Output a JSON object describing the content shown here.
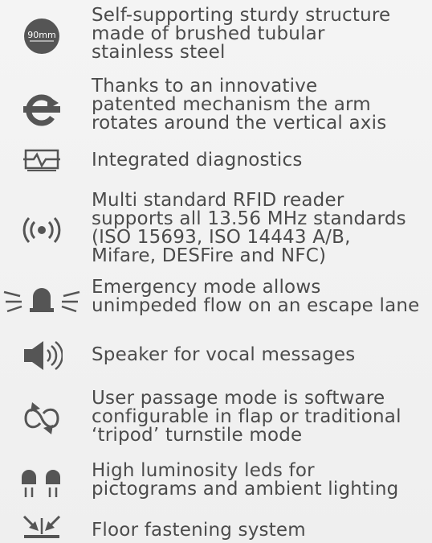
{
  "features": [
    {
      "icon": "tube-diameter-icon",
      "badge": "90mm",
      "text": "Self-supporting sturdy structure\nmade of brushed tubular\nstainless steel"
    },
    {
      "icon": "rotation-icon",
      "text": "Thanks to an innovative\npatented mechanism the arm\nrotates around the vertical axis"
    },
    {
      "icon": "diagnostics-icon",
      "text": "Integrated diagnostics"
    },
    {
      "icon": "rfid-icon",
      "text": "Multi standard RFID reader\nsupports all 13.56 MHz standards\n(ISO 15693, ISO 14443 A/B,\nMifare, DESFire and NFC)"
    },
    {
      "icon": "emergency-light-icon",
      "text": "Emergency mode allows\nunimpeded flow on an escape lane"
    },
    {
      "icon": "speaker-icon",
      "text": "Speaker for vocal messages"
    },
    {
      "icon": "passage-mode-icon",
      "text": "User passage mode is software\nconfigurable in flap or traditional\n‘tripod’ turnstile mode"
    },
    {
      "icon": "led-icon",
      "text": "High luminosity leds for\npictograms and ambient lighting"
    },
    {
      "icon": "floor-fastening-icon",
      "text": "Floor fastening system"
    }
  ],
  "colors": {
    "text": "#4b4b4b",
    "icon": "#555555",
    "background": "#f2f2f2"
  }
}
